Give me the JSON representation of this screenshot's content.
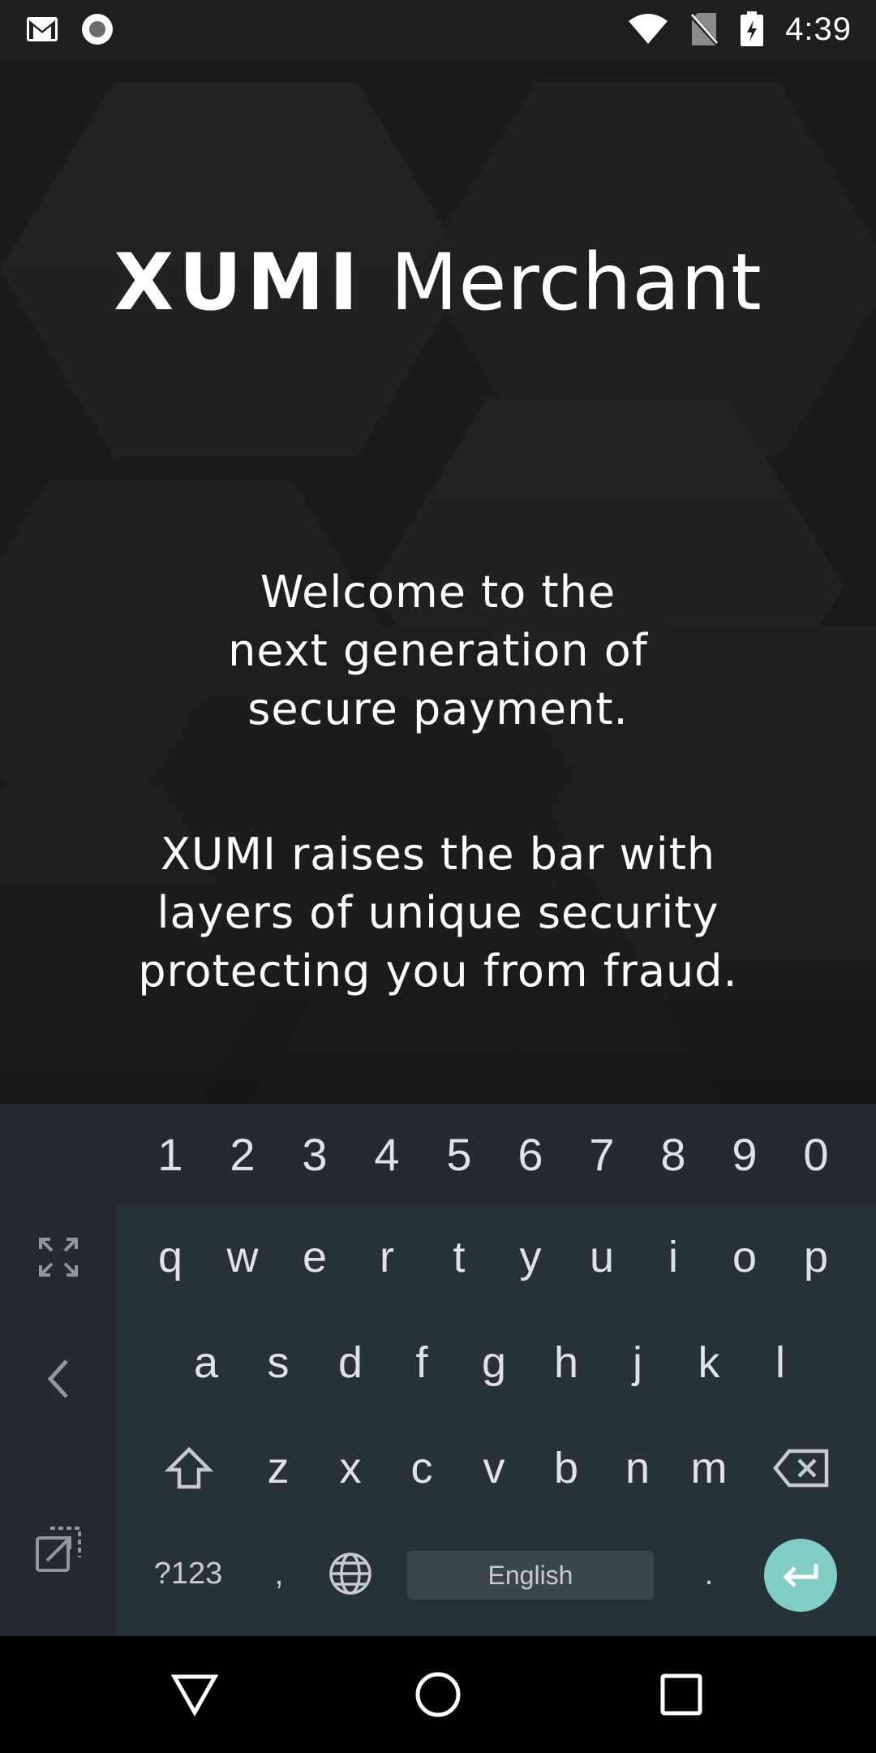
{
  "status_bar": {
    "time": "4:39",
    "left_icons": [
      "gmail-icon",
      "record-icon"
    ],
    "right_icons": [
      "wifi-icon",
      "no-sim-icon",
      "battery-charging-icon"
    ]
  },
  "hero": {
    "brand_strong": "XUMI",
    "brand_light": "Merchant",
    "welcome_lines": [
      "Welcome to the",
      "next generation of",
      "secure payment."
    ],
    "tagline_lines": [
      "XUMI raises the bar with",
      "layers of unique security",
      "protecting you from fraud."
    ]
  },
  "keyboard": {
    "numbers": [
      "1",
      "2",
      "3",
      "4",
      "5",
      "6",
      "7",
      "8",
      "9",
      "0"
    ],
    "row1": [
      "q",
      "w",
      "e",
      "r",
      "t",
      "y",
      "u",
      "i",
      "o",
      "p"
    ],
    "row2": [
      "a",
      "s",
      "d",
      "f",
      "g",
      "h",
      "j",
      "k",
      "l"
    ],
    "row3": [
      "z",
      "x",
      "c",
      "v",
      "b",
      "n",
      "m"
    ],
    "symbols_label": "?123",
    "comma": ",",
    "period": ".",
    "space_label": "English",
    "enter_color": "#7fcdc3"
  },
  "colors": {
    "keyboard_bg": "#263238",
    "keyboard_side_bg": "#222b30",
    "hero_bg": "#1a1a1a"
  }
}
